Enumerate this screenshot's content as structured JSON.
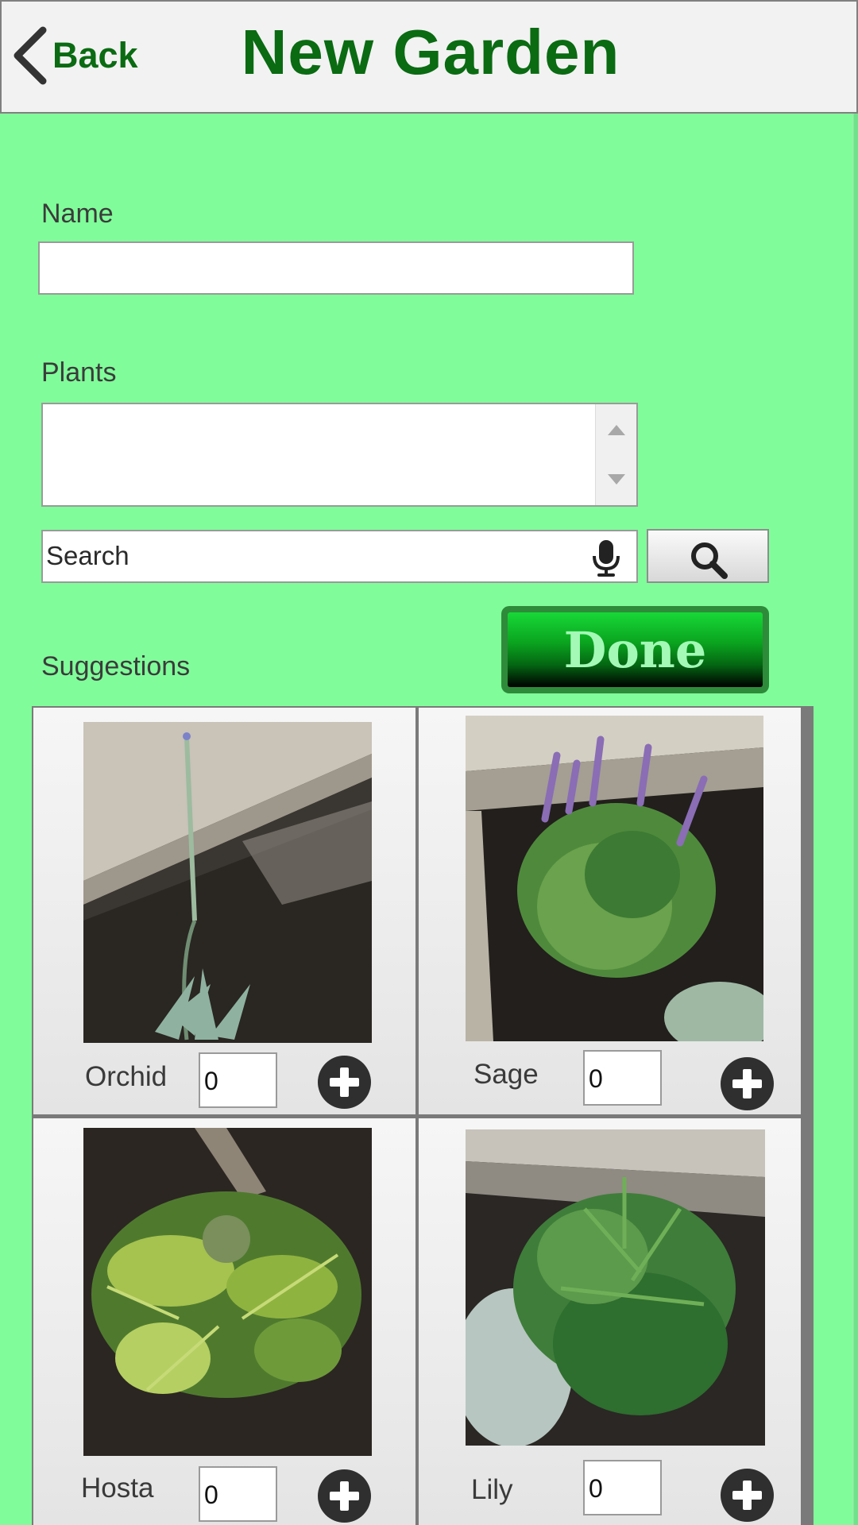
{
  "header": {
    "back_label": "Back",
    "title": "New Garden"
  },
  "form": {
    "name_label": "Name",
    "name_value": "",
    "plants_label": "Plants",
    "search_placeholder": "Search",
    "done_label": "Done",
    "suggestions_label": "Suggestions"
  },
  "suggestions": [
    {
      "name": "Orchid",
      "qty": "0"
    },
    {
      "name": "Sage",
      "qty": "0"
    },
    {
      "name": "Hosta",
      "qty": "0"
    },
    {
      "name": "Lily",
      "qty": "0"
    }
  ],
  "colors": {
    "background": "#80fd9a",
    "title": "#0a6b12",
    "done_gradient_top": "#18d838",
    "done_text": "#a4f9b7"
  },
  "icons": [
    "back-chevron-icon",
    "microphone-icon",
    "magnifier-icon",
    "plus-circle-icon"
  ]
}
